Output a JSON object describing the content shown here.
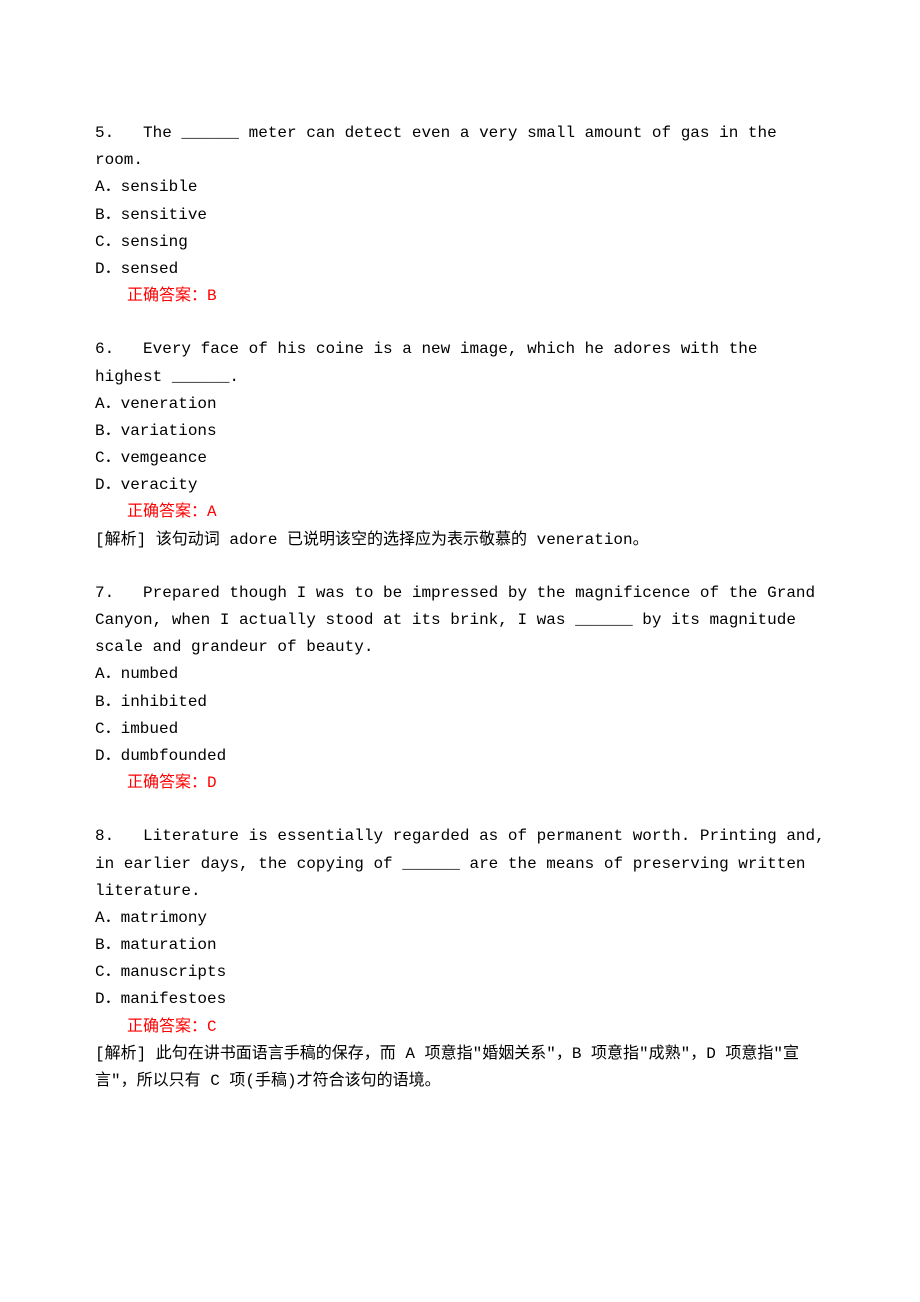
{
  "questions": [
    {
      "number": "5.",
      "text": "   The ______ meter can detect even a very small amount of gas in the room.",
      "options": [
        "A．sensible",
        "B．sensitive",
        "C．sensing",
        "D．sensed"
      ],
      "answer": "正确答案：B",
      "analysis": ""
    },
    {
      "number": "6.",
      "text": "   Every face of his coine is a new image, which he adores with the highest ______.",
      "options": [
        "A．veneration",
        "B．variations",
        "C．vemgeance",
        "D．veracity"
      ],
      "answer": "正确答案：A",
      "analysis": "[解析] 该句动词 adore 已说明该空的选择应为表示敬慕的 veneration。"
    },
    {
      "number": "7.",
      "text": "   Prepared though I was to be impressed by the magnificence of the Grand Canyon, when I actually stood at its brink, I was ______ by its magnitude scale and grandeur of beauty.",
      "options": [
        "A．numbed",
        "B．inhibited",
        "C．imbued",
        "D．dumbfounded"
      ],
      "answer": "正确答案：D",
      "analysis": ""
    },
    {
      "number": "8.",
      "text": "   Literature is essentially regarded as of permanent worth. Printing and, in earlier days, the copying of ______ are the means of preserving written literature.",
      "options": [
        "A．matrimony",
        "B．maturation",
        "C．manuscripts",
        "D．manifestoes"
      ],
      "answer": "正确答案：C",
      "analysis": "[解析] 此句在讲书面语言手稿的保存，而 A 项意指\"婚姻关系\"，B 项意指\"成熟\"，D 项意指\"宣言\"，所以只有 C 项(手稿)才符合该句的语境。"
    }
  ]
}
